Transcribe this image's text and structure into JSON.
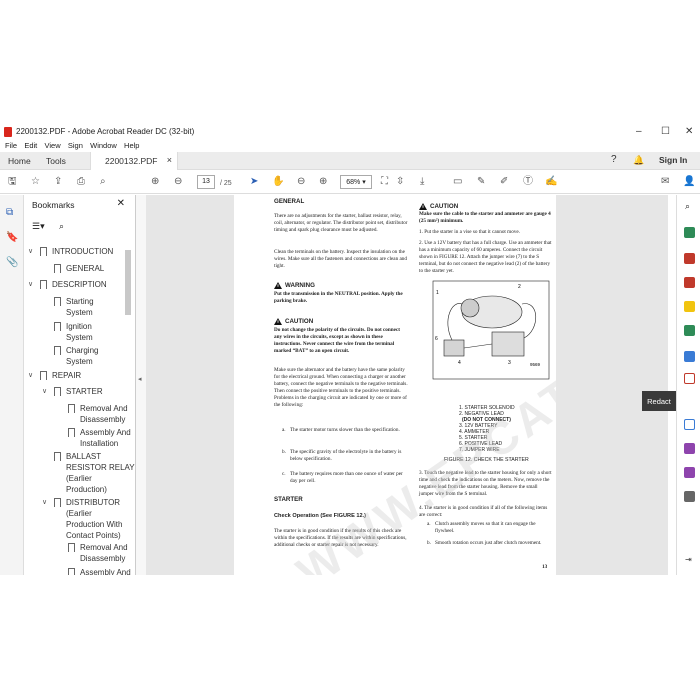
{
  "window": {
    "title": "2200132.PDF - Adobe Acrobat Reader DC (32-bit)",
    "minimize": "–",
    "maximize": "☐",
    "close": "✕"
  },
  "menu": [
    "File",
    "Edit",
    "View",
    "Sign",
    "Window",
    "Help"
  ],
  "tabs": {
    "home": "Home",
    "tools": "Tools",
    "doc": "2200132.PDF",
    "doc_close": "×",
    "sign_in": "Sign In"
  },
  "toolbar": {
    "page_current": "13",
    "page_total": "/ 25",
    "zoom": "68%"
  },
  "bookmarks": {
    "header": "Bookmarks",
    "close": "✕",
    "items": [
      {
        "chev": "∨",
        "label": "INTRODUCTION"
      },
      {
        "chev": "",
        "label": "GENERAL"
      },
      {
        "chev": "∨",
        "label": "DESCRIPTION"
      },
      {
        "chev": "",
        "label": "Starting\nSystem"
      },
      {
        "chev": "",
        "label": "Ignition\nSystem"
      },
      {
        "chev": "",
        "label": "Charging\nSystem"
      },
      {
        "chev": "∨",
        "label": "REPAIR"
      },
      {
        "chev": "∨",
        "label": "STARTER"
      },
      {
        "chev": "",
        "label": "Removal And\nDisassembly"
      },
      {
        "chev": "",
        "label": "Assembly And\nInstallation"
      },
      {
        "chev": "",
        "label": "BALLAST\nRESISTOR RELAY\n(Earlier\nProduction)"
      },
      {
        "chev": "∨",
        "label": "DISTRIBUTOR\n(Earlier\nProduction With\nContact Points)"
      },
      {
        "chev": "",
        "label": "Removal And\nDisassembly"
      },
      {
        "chev": "",
        "label": "Assembly And"
      }
    ]
  },
  "tooltip": "Redact",
  "doc": {
    "left": {
      "general_heading": "GENERAL",
      "p1": "There are no adjustments for the starter, ballast resistor, relay, coil, alternator, or regulator. The distributor point set, distributor timing and spark plug clearance must be adjusted.",
      "p2": "Clean the terminals on the battery. Inspect the insulation on the wires. Make sure all the fasteners and connections are clean and tight.",
      "warning_label": "WARNING",
      "warning_text": "Put the transmission in the NEUTRAL position. Apply the parking brake.",
      "caution_label": "CAUTION",
      "caution_text": "Do not change the polarity of the circuits. Do not connect any wires in the circuits, except as shown in these instructions. Never connect the wire from the terminal marked “BAT” to an open circuit.",
      "p3": "Make sure the alternator and the battery have the same polarity for the electrical ground. When connecting a charger or another battery, connect the negative terminals to the negative terminals. Then connect the positive terminals to the positive terminals. Problems in the charging circuit are indicated by one or more of the following:",
      "la": "a.",
      "la_text": "The starter motor turns slower than the specification.",
      "lb": "b.",
      "lb_text": "The specific gravity of the electrolyte in the battery is below specification.",
      "lc": "c.",
      "lc_text": "The battery requires more than one ounce of water per day per cell.",
      "starter_heading": "STARTER",
      "check_heading": "Check Operation (See FIGURE 12.)",
      "p4": "The starter is in good condition if the results of this check are within the specifications. If the results are within specifications, additional checks or starter repair is not necessary."
    },
    "right": {
      "caution_label": "CAUTION",
      "caution_text": "Make sure the cable to the starter and ammeter are gauge 4 (25 mm²) minimum.",
      "s1": "1. Put the starter in a vise so that it cannot move.",
      "s2": "2. Use a 12V battery that has a full charge. Use an ammeter that has a minimum capacity of 60 amperes. Connect the circuit shown in FIGURE 12. Attach the jumper wire (7) to the S terminal, but do not connect the negative lead (2) of the battery to the starter yet.",
      "legend": [
        "1. STARTER SOLENOID",
        "2. NEGATIVE LEAD",
        "(DO NOT CONNECT)",
        "3. 12V BATTERY",
        "4. AMMETER",
        "5. STARTER",
        "6. POSITIVE LEAD",
        "7. JUMPER WIRE"
      ],
      "fig_num": "9569",
      "fig_caption": "FIGURE 12. CHECK THE STARTER",
      "s3": "3. Touch the negative lead to the starter housing for only a short time and check the indications on the meters. Now, remove the negative lead from the starter housing. Remove the small jumper wire from the S terminal.",
      "s4": "4. The starter is in good condition if all of the following items are correct:",
      "ia": "a.",
      "ia_text": "Clutch assembly moves so that it can engage the flywheel.",
      "ib": "b.",
      "ib_text": "Smooth rotation occurs just after clutch movement.",
      "page_number": "13"
    },
    "watermark": "WWW.EPCATALOGS.COM"
  }
}
